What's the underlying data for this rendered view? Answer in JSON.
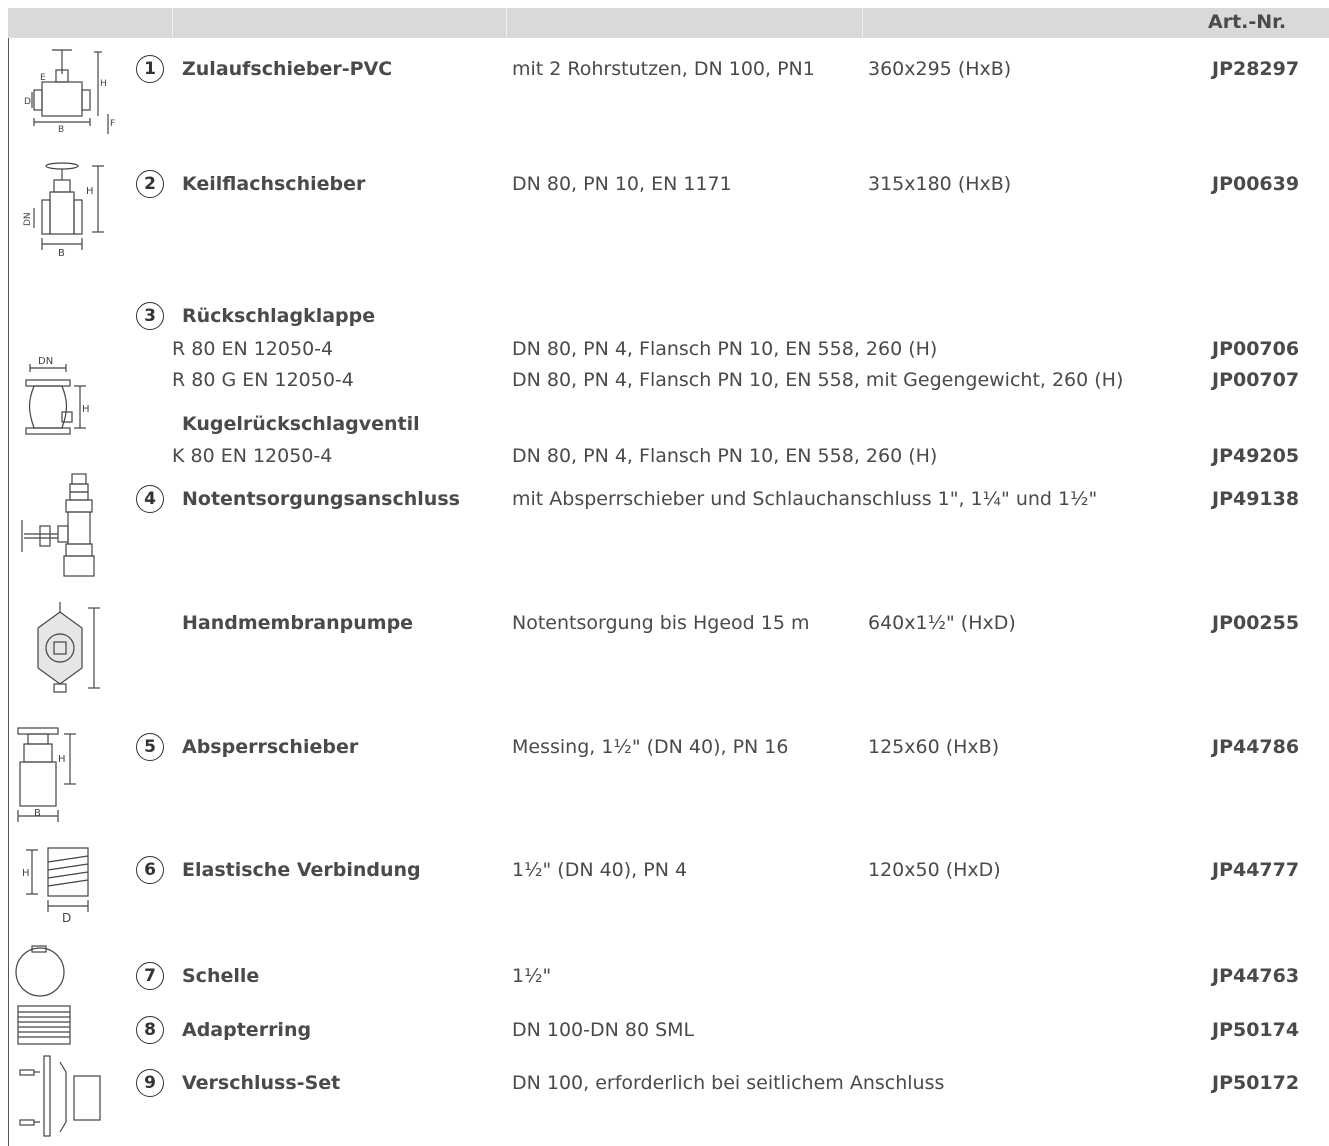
{
  "header": {
    "art_nr": "Art.-Nr."
  },
  "rows": [
    {
      "num": "1",
      "name": "Zulaufschieber-PVC",
      "desc": "mit 2 Rohrstutzen, DN 100, PN1",
      "dim": "360x295 (HxB)",
      "art": "JP28297",
      "icon": "gate-valve-pvc-drawing-icon"
    },
    {
      "num": "2",
      "name": "Keilflachschieber",
      "desc": "DN 80, PN 10, EN 1171",
      "dim": "315x180 (HxB)",
      "art": "JP00639",
      "icon": "wedge-gate-valve-drawing-icon"
    },
    {
      "num": "3",
      "name": "Rückschlagklappe",
      "sub": [
        {
          "code": "R 80   EN 12050-4",
          "desc": "DN 80, PN 4, Flansch PN 10, EN 558, 260 (H)",
          "art": "JP00706"
        },
        {
          "code": "R 80 G   EN 12050-4",
          "desc": "DN 80, PN 4, Flansch PN 10, EN 558, mit Gegengewicht, 260 (H)",
          "art": "JP00707"
        }
      ],
      "name2": "Kugelrückschlagventil",
      "sub2": {
        "code": "K 80    EN 12050-4",
        "desc": "DN 80, PN 4, Flansch PN 10, EN 558, 260 (H)",
        "art": "JP49205"
      },
      "icon": "check-valve-drawing-icon"
    },
    {
      "num": "4",
      "name": "Notentsorgungsanschluss",
      "desc": "mit Absperrschieber und Schlauchanschluss 1\", 1¼\" und 1½\"",
      "art": "JP49138",
      "icon": "emergency-connection-drawing-icon"
    },
    {
      "num": "",
      "name": "Handmembranpumpe",
      "desc": "Notentsorgung bis Hgeod 15 m",
      "dim": "640x1½\" (HxD)",
      "art": "JP00255",
      "icon": "hand-diaphragm-pump-drawing-icon"
    },
    {
      "num": "5",
      "name": "Absperrschieber",
      "desc": "Messing, 1½\" (DN 40), PN 16",
      "dim": "125x60 (HxB)",
      "art": "JP44786",
      "icon": "shutoff-valve-drawing-icon"
    },
    {
      "num": "6",
      "name": "Elastische Verbindung",
      "desc": "1½\" (DN 40), PN 4",
      "dim": "120x50 (HxD)",
      "art": "JP44777",
      "icon": "elastic-connector-drawing-icon"
    },
    {
      "num": "7",
      "name": "Schelle",
      "desc": "1½\"",
      "art": "JP44763",
      "icon": "pipe-clamp-drawing-icon"
    },
    {
      "num": "8",
      "name": "Adapterring",
      "desc": "DN 100-DN 80 SML",
      "art": "JP50174",
      "icon": "adapter-ring-drawing-icon"
    },
    {
      "num": "9",
      "name": "Verschluss-Set",
      "desc": "DN 100, erforderlich bei seitlichem Anschluss",
      "art": "JP50172",
      "icon": "closure-set-drawing-icon"
    }
  ],
  "drawing_labels": {
    "D": "D",
    "E": "E",
    "F": "F",
    "H": "H",
    "B": "B",
    "DN": "DN"
  }
}
